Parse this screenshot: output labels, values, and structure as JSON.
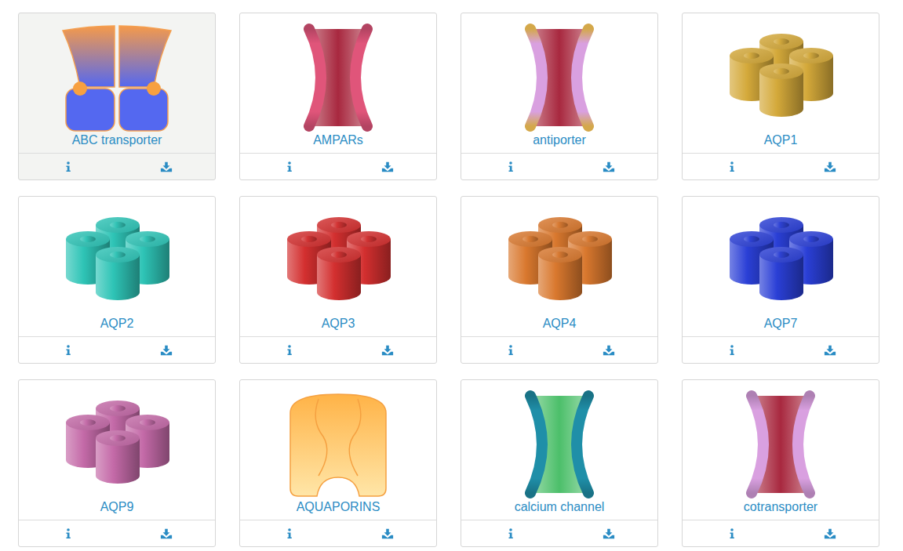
{
  "items": [
    {
      "name": "ABC transporter",
      "kind": "abc",
      "color": "#5468f0",
      "selected": true
    },
    {
      "name": "AMPARs",
      "kind": "channel",
      "color": "#e0557a",
      "selected": false
    },
    {
      "name": "antiporter",
      "kind": "antiporter",
      "color": "#d9a0e0",
      "selected": false
    },
    {
      "name": "AQP1",
      "kind": "tetramer",
      "color": "#d4a93a",
      "selected": false
    },
    {
      "name": "AQP2",
      "kind": "tetramer",
      "color": "#2ec4b6",
      "selected": false
    },
    {
      "name": "AQP3",
      "kind": "tetramer",
      "color": "#d32f2f",
      "selected": false
    },
    {
      "name": "AQP4",
      "kind": "tetramer",
      "color": "#d9782e",
      "selected": false
    },
    {
      "name": "AQP7",
      "kind": "tetramer",
      "color": "#2a3fd6",
      "selected": false
    },
    {
      "name": "AQP9",
      "kind": "tetramer",
      "color": "#c46aa8",
      "selected": false
    },
    {
      "name": "AQUAPORINS",
      "kind": "aquaporin",
      "color": "#ffb347",
      "selected": false
    },
    {
      "name": "calcium channel",
      "kind": "channel",
      "color": "#1f8fa8",
      "selected": false
    },
    {
      "name": "cotransporter",
      "kind": "antiporter",
      "color": "#d9a0e0",
      "selected": false
    }
  ]
}
